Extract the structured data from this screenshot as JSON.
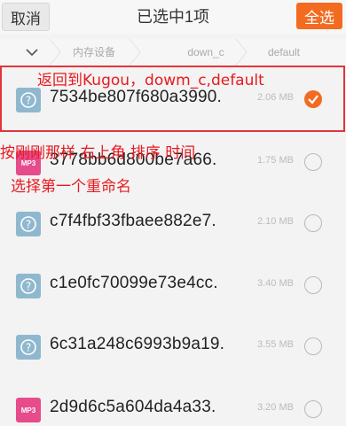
{
  "header": {
    "cancel_label": "取消",
    "title": "已选中1项",
    "select_all_label": "全选"
  },
  "breadcrumb": {
    "items": [
      "内存设备",
      "down_c",
      "default"
    ]
  },
  "files": [
    {
      "name": "7534be807f680a3990.",
      "size": "2.06 MB",
      "icon": "unknown-file-icon",
      "checked": true
    },
    {
      "name": "3778bb6d800be7a66.",
      "size": "1.75 MB",
      "icon": "mp3-file-icon",
      "checked": false
    },
    {
      "name": "c7f4fbf33fbaee882e7.",
      "size": "2.10 MB",
      "icon": "unknown-file-icon",
      "checked": false
    },
    {
      "name": "c1e0fc70099e73e4cc.",
      "size": "3.40 MB",
      "icon": "unknown-file-icon",
      "checked": false
    },
    {
      "name": "6c31a248c6993b9a19.",
      "size": "3.55 MB",
      "icon": "unknown-file-icon",
      "checked": false
    },
    {
      "name": "2d9d6c5a604da4a33.",
      "size": "3.20 MB",
      "icon": "mp3-file-icon",
      "checked": false
    }
  ],
  "mp3_label": "MP3",
  "annotations": {
    "note1": "返回到Kugou，dowm_c,default",
    "note2": "按刚刚那样 右上角  排序 时间",
    "note3": "选择第一个重命名"
  },
  "colors": {
    "accent": "#f26b21",
    "annotation_red": "#e8191f",
    "mp3_icon": "#e64b8b",
    "unknown_icon": "#8fb8cf"
  }
}
